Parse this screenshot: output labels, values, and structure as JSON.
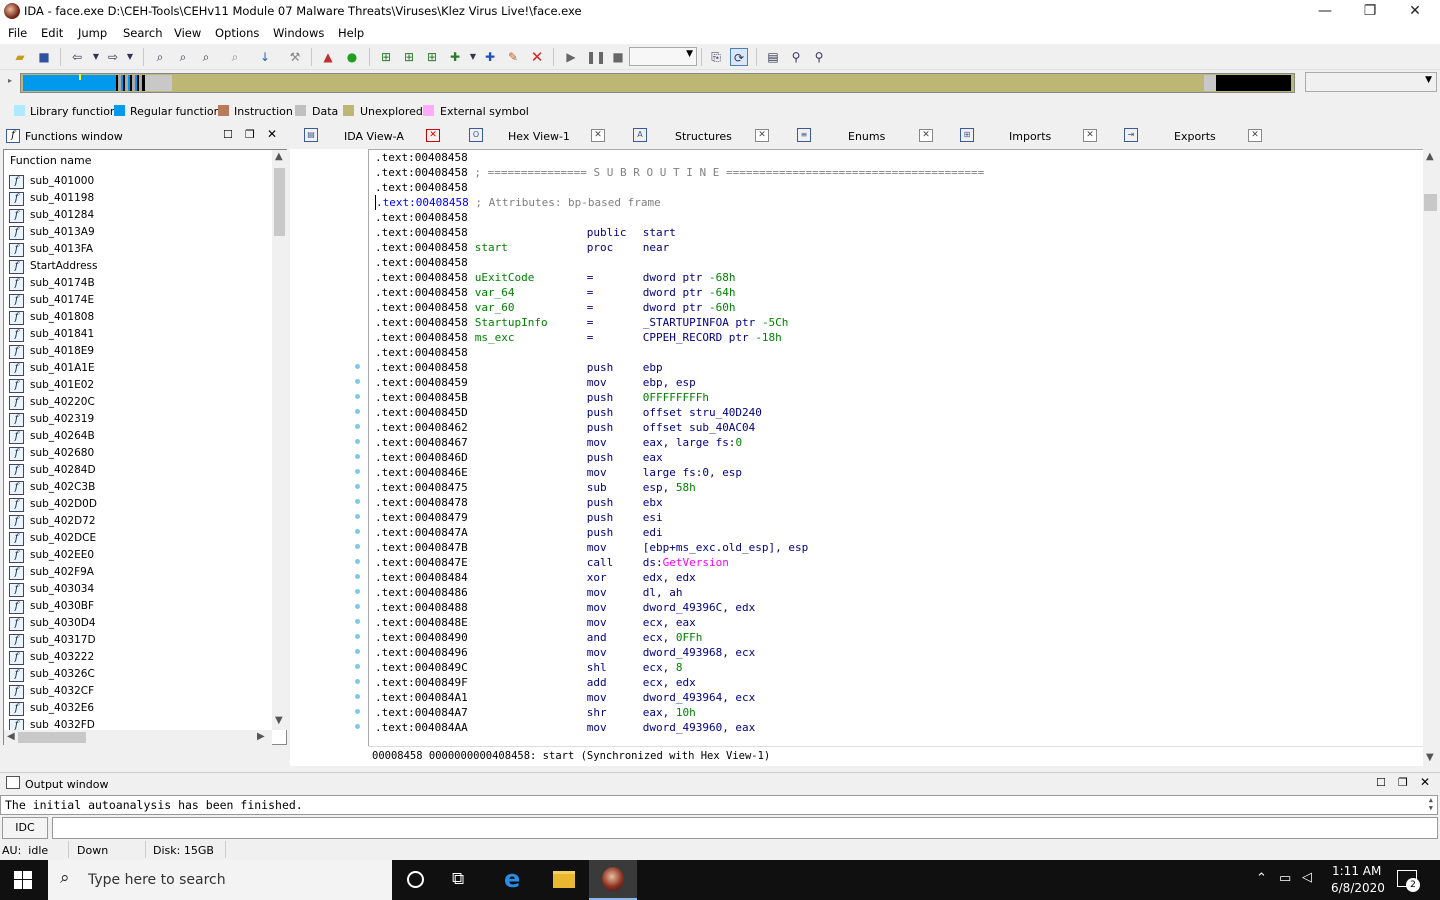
{
  "window": {
    "title": "IDA - face.exe D:\\CEH-Tools\\CEHv11 Module 07 Malware Threats\\Viruses\\Klez Virus Live!\\face.exe",
    "minimize": "—",
    "restore": "❐",
    "close": "✕"
  },
  "menu": [
    "File",
    "Edit",
    "Jump",
    "Search",
    "View",
    "Options",
    "Windows",
    "Help"
  ],
  "legend": [
    {
      "label": "Library function",
      "color": "#aee9ff"
    },
    {
      "label": "Regular function",
      "color": "#0099ee"
    },
    {
      "label": "Instruction",
      "color": "#b87a5a"
    },
    {
      "label": "Data",
      "color": "#c0c0c0"
    },
    {
      "label": "Unexplored",
      "color": "#bdb776"
    },
    {
      "label": "External symbol",
      "color": "#ffaaff"
    }
  ],
  "functions_window": {
    "title": "Functions window",
    "column_header": "Function name",
    "items": [
      "sub_401000",
      "sub_401198",
      "sub_401284",
      "sub_4013A9",
      "sub_4013FA",
      "StartAddress",
      "sub_40174B",
      "sub_40174E",
      "sub_401808",
      "sub_401841",
      "sub_4018E9",
      "sub_401A1E",
      "sub_401E02",
      "sub_40220C",
      "sub_402319",
      "sub_40264B",
      "sub_402680",
      "sub_40284D",
      "sub_402C3B",
      "sub_402D0D",
      "sub_402D72",
      "sub_402DCE",
      "sub_402EE0",
      "sub_402F9A",
      "sub_403034",
      "sub_4030BF",
      "sub_4030D4",
      "sub_40317D",
      "sub_403222",
      "sub_40326C",
      "sub_4032CF",
      "sub_4032E6",
      "sub_4032FD"
    ]
  },
  "tabs": [
    {
      "label": "IDA View-A",
      "icon": "IDA"
    },
    {
      "label": "Hex View-1",
      "icon": "O"
    },
    {
      "label": "Structures",
      "icon": "A"
    },
    {
      "label": "Enums",
      "icon": "≡"
    },
    {
      "label": "Imports",
      "icon": "⊞"
    },
    {
      "label": "Exports",
      "icon": "⇥"
    }
  ],
  "disasm_lines": [
    {
      "addr": ".text:00408458",
      "label": "",
      "mnem": "",
      "ops": "",
      "comment": ""
    },
    {
      "addr": ".text:00408458",
      "label": "",
      "mnem": "",
      "ops": "",
      "comment": "; =============== S U B R O U T I N E ======================================="
    },
    {
      "addr": ".text:00408458",
      "label": "",
      "mnem": "",
      "ops": "",
      "comment": ""
    },
    {
      "addr": ".text:00408458",
      "label": "",
      "mnem": "",
      "ops": "",
      "comment": "; Attributes: bp-based frame"
    },
    {
      "addr": ".text:00408458",
      "label": "",
      "mnem": "",
      "ops": "",
      "comment": ""
    },
    {
      "addr": ".text:00408458",
      "label": "",
      "mnem": "public",
      "ops": "start",
      "comment": ""
    },
    {
      "addr": ".text:00408458",
      "label": "start",
      "mnem": "proc",
      "ops": "near",
      "comment": ""
    },
    {
      "addr": ".text:00408458",
      "label": "",
      "mnem": "",
      "ops": "",
      "comment": ""
    },
    {
      "addr": ".text:00408458",
      "label": "uExitCode",
      "mnem": "=",
      "ops": "dword ptr -68h",
      "comment": ""
    },
    {
      "addr": ".text:00408458",
      "label": "var_64",
      "mnem": "=",
      "ops": "dword ptr -64h",
      "comment": ""
    },
    {
      "addr": ".text:00408458",
      "label": "var_60",
      "mnem": "=",
      "ops": "dword ptr -60h",
      "comment": ""
    },
    {
      "addr": ".text:00408458",
      "label": "StartupInfo",
      "mnem": "=",
      "ops": "_STARTUPINFOA ptr -5Ch",
      "comment": ""
    },
    {
      "addr": ".text:00408458",
      "label": "ms_exc",
      "mnem": "=",
      "ops": "CPPEH_RECORD ptr -18h",
      "comment": ""
    },
    {
      "addr": ".text:00408458",
      "label": "",
      "mnem": "",
      "ops": "",
      "comment": ""
    },
    {
      "addr": ".text:00408458",
      "label": "",
      "mnem": "push",
      "ops": "ebp",
      "comment": ""
    },
    {
      "addr": ".text:00408459",
      "label": "",
      "mnem": "mov",
      "ops": "ebp, esp",
      "comment": ""
    },
    {
      "addr": ".text:0040845B",
      "label": "",
      "mnem": "push",
      "ops": "0FFFFFFFFh",
      "comment": ""
    },
    {
      "addr": ".text:0040845D",
      "label": "",
      "mnem": "push",
      "ops": "offset stru_40D240",
      "comment": ""
    },
    {
      "addr": ".text:00408462",
      "label": "",
      "mnem": "push",
      "ops": "offset sub_40AC04",
      "comment": ""
    },
    {
      "addr": ".text:00408467",
      "label": "",
      "mnem": "mov",
      "ops": "eax, large fs:0",
      "comment": ""
    },
    {
      "addr": ".text:0040846D",
      "label": "",
      "mnem": "push",
      "ops": "eax",
      "comment": ""
    },
    {
      "addr": ".text:0040846E",
      "label": "",
      "mnem": "mov",
      "ops": "large fs:0, esp",
      "comment": ""
    },
    {
      "addr": ".text:00408475",
      "label": "",
      "mnem": "sub",
      "ops": "esp, 58h",
      "comment": ""
    },
    {
      "addr": ".text:00408478",
      "label": "",
      "mnem": "push",
      "ops": "ebx",
      "comment": ""
    },
    {
      "addr": ".text:00408479",
      "label": "",
      "mnem": "push",
      "ops": "esi",
      "comment": ""
    },
    {
      "addr": ".text:0040847A",
      "label": "",
      "mnem": "push",
      "ops": "edi",
      "comment": ""
    },
    {
      "addr": ".text:0040847B",
      "label": "",
      "mnem": "mov",
      "ops": "[ebp+ms_exc.old_esp], esp",
      "comment": ""
    },
    {
      "addr": ".text:0040847E",
      "label": "",
      "mnem": "call",
      "ops": "ds:GetVersion",
      "comment": ""
    },
    {
      "addr": ".text:00408484",
      "label": "",
      "mnem": "xor",
      "ops": "edx, edx",
      "comment": ""
    },
    {
      "addr": ".text:00408486",
      "label": "",
      "mnem": "mov",
      "ops": "dl, ah",
      "comment": ""
    },
    {
      "addr": ".text:00408488",
      "label": "",
      "mnem": "mov",
      "ops": "dword_49396C, edx",
      "comment": ""
    },
    {
      "addr": ".text:0040848E",
      "label": "",
      "mnem": "mov",
      "ops": "ecx, eax",
      "comment": ""
    },
    {
      "addr": ".text:00408490",
      "label": "",
      "mnem": "and",
      "ops": "ecx, 0FFh",
      "comment": ""
    },
    {
      "addr": ".text:00408496",
      "label": "",
      "mnem": "mov",
      "ops": "dword_493968, ecx",
      "comment": ""
    },
    {
      "addr": ".text:0040849C",
      "label": "",
      "mnem": "shl",
      "ops": "ecx, 8",
      "comment": ""
    },
    {
      "addr": ".text:0040849F",
      "label": "",
      "mnem": "add",
      "ops": "ecx, edx",
      "comment": ""
    },
    {
      "addr": ".text:004084A1",
      "label": "",
      "mnem": "mov",
      "ops": "dword_493964, ecx",
      "comment": ""
    },
    {
      "addr": ".text:004084A7",
      "label": "",
      "mnem": "shr",
      "ops": "eax, 10h",
      "comment": ""
    },
    {
      "addr": ".text:004084AA",
      "label": "",
      "mnem": "mov",
      "ops": "dword_493960, eax",
      "comment": ""
    }
  ],
  "disasm_status": "00008458 0000000000408458: start (Synchronized with Hex View-1)",
  "output_window": {
    "title": "Output window",
    "text": "The initial autoanalysis has been finished.",
    "idc_label": "IDC"
  },
  "statusbar": {
    "au": "AU:  idle",
    "direction": "Down",
    "disk": "Disk: 15GB"
  },
  "taskbar": {
    "search_placeholder": "Type here to search",
    "time": "1:11 AM",
    "date": "6/8/2020",
    "notification_count": "2"
  },
  "colors": {
    "code_blue": "#000080",
    "label_green": "#008000",
    "number_green": "#008000",
    "import_magenta": "#ff00ff",
    "comment_gray": "#808080",
    "addr_black": "#000000"
  }
}
